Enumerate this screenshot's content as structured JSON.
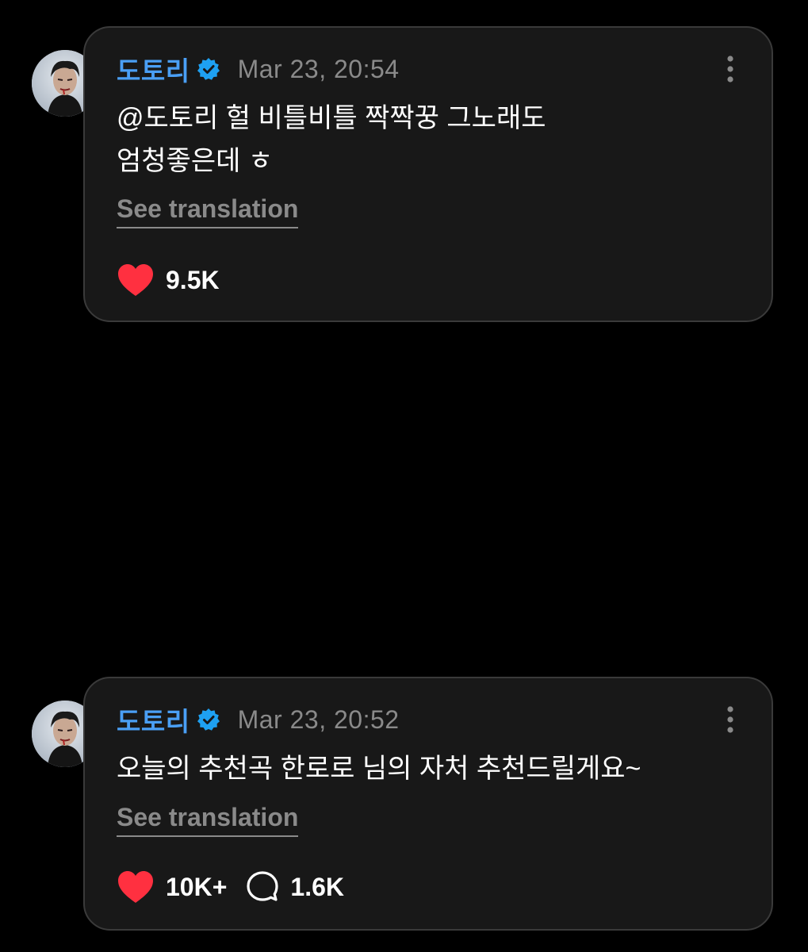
{
  "posts": [
    {
      "username": "도토리",
      "timestamp": "Mar 23, 20:54",
      "text": "@도토리 헐 비틀비틀 짝짝꿍 그노래도\n엄청좋은데 ㅎ",
      "translate_label": "See translation",
      "likes": "9.5K"
    },
    {
      "username": "도토리",
      "timestamp": "Mar 23, 20:52",
      "text": "오늘의 추천곡 한로로 님의 자처 추천드릴게요~",
      "translate_label": "See translation",
      "likes": "10K+",
      "comments": "1.6K"
    }
  ],
  "colors": {
    "username": "#4a9ff5",
    "verified_badge": "#1ea1f2",
    "heart": "#ff3040",
    "muted_text": "#8a8a8a",
    "card_bg": "#181818",
    "card_border": "#3a3a3a"
  },
  "icons": [
    "verified-badge-icon",
    "more-options-icon",
    "heart-icon",
    "comment-icon"
  ]
}
